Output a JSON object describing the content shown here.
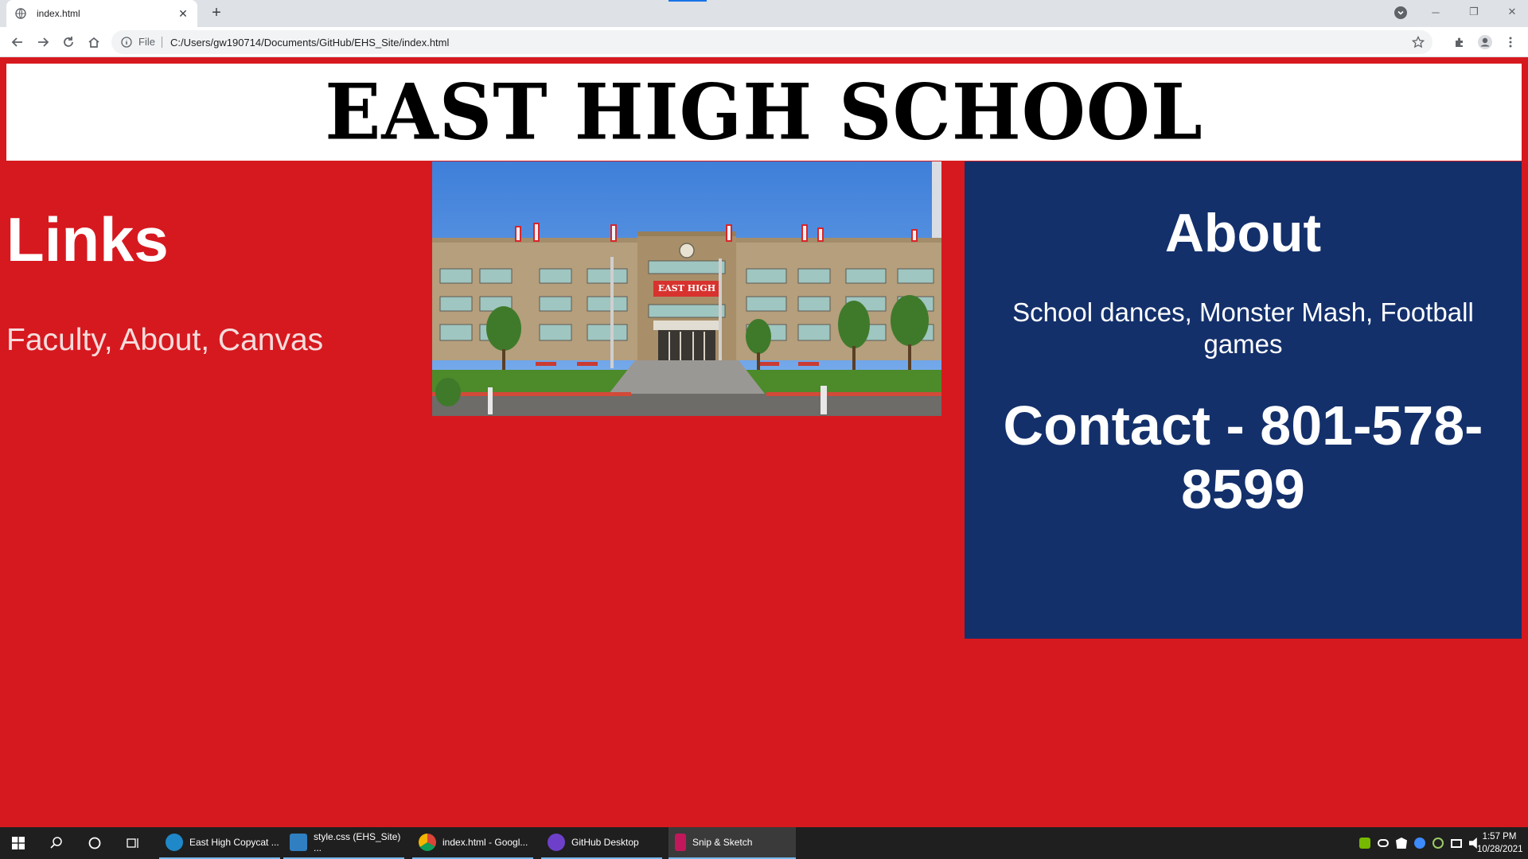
{
  "browser": {
    "tab_title": "index.html",
    "scheme_label": "File",
    "url": "C:/Users/gw190714/Documents/GitHub/EHS_Site/index.html"
  },
  "page": {
    "header_title": "EAST HIGH SCHOOL",
    "links_heading": "Links",
    "links_text": "Faculty, About, Canvas",
    "about_heading": "About",
    "about_text": "School dances, Monster Mash, Football games",
    "contact_text": "Contact - 801-578-8599",
    "photo_sign_text": "EAST HIGH",
    "colors": {
      "page_bg": "#d6191f",
      "about_bg": "#13306b",
      "header_bg": "#ffffff"
    }
  },
  "taskbar": {
    "apps": [
      {
        "label": "East High Copycat ...",
        "icon": "edge-icon",
        "color": "#1e88c8"
      },
      {
        "label": "style.css (EHS_Site) ...",
        "icon": "brackets-icon",
        "color": "#2f7fc1"
      },
      {
        "label": "index.html - Googl...",
        "icon": "chrome-icon",
        "color": "#e8a13a"
      },
      {
        "label": "GitHub Desktop",
        "icon": "github-desktop-icon",
        "color": "#6e40c9"
      },
      {
        "label": "Snip & Sketch",
        "icon": "snip-sketch-icon",
        "color": "#c2185b"
      }
    ],
    "time": "1:57 PM",
    "date": "10/28/2021"
  }
}
